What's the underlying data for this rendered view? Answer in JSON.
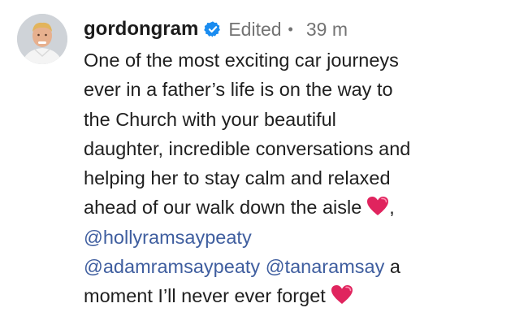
{
  "comment": {
    "username": "gordongram",
    "edited_label": "Edited",
    "separator": "•",
    "timestamp": "39 m",
    "verified_icon": "verified-badge-icon",
    "lines": {
      "l1": "One of the most exciting car journeys",
      "l2": "ever in a father’s life is on the way to",
      "l3": "the Church with your beautiful",
      "l4": "daughter, incredible conversations and",
      "l5": "helping her to stay calm and relaxed",
      "l6": "ahead of our walk down the aisle",
      "l6_suffix": ",",
      "l9_suffix": " a",
      "l10": "moment I’ll never ever forget"
    },
    "mentions": {
      "m1": "@hollyramsaypeaty",
      "m2": "@adamramsaypeaty",
      "m3": "@tanaramsay"
    },
    "emoji": "heart-emoji"
  },
  "colors": {
    "mention": "#3f5e9f",
    "verified": "#1a8cf0",
    "heart": "#e0245e",
    "meta": "#737373"
  }
}
